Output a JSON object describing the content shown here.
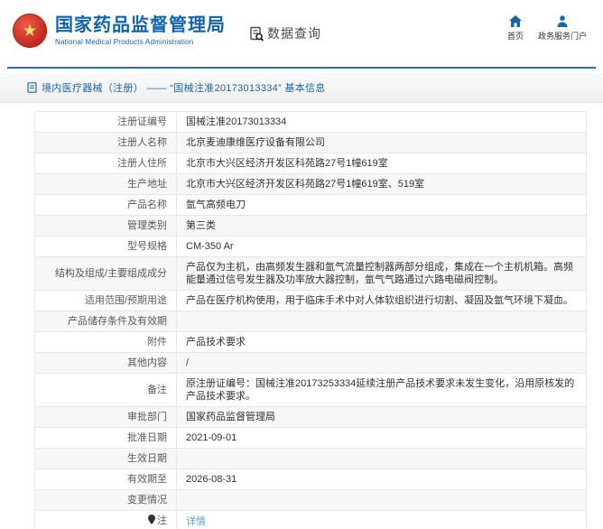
{
  "header": {
    "title_cn": "国家药品监督管理局",
    "title_en": "National Medical Products Administration",
    "section_label": "数据查询",
    "nav": [
      {
        "label": "首页",
        "icon": "home-icon"
      },
      {
        "label": "政务服务门户",
        "icon": "user-icon"
      }
    ]
  },
  "breadcrumb": {
    "icon": "document-icon",
    "text": "境内医疗器械（注册） —— “国械注准20173013334” 基本信息"
  },
  "colors": {
    "brand_blue": "#1064ad",
    "rule_blue": "#2f6ea8",
    "breadcrumb_text": "#1b66a8",
    "link_blue": "#55a1d8",
    "emblem_red": "#c0271a",
    "emblem_gold": "#ffd874"
  },
  "table": {
    "rows": [
      {
        "label": "注册证编号",
        "value": "国械注准20173013334"
      },
      {
        "label": "注册人名称",
        "value": "北京麦迪康维医疗设备有限公司"
      },
      {
        "label": "注册人住所",
        "value": "北京市大兴区经济开发区科苑路27号1幢619室"
      },
      {
        "label": "生产地址",
        "value": "北京市大兴区经济开发区科苑路27号1幢619室、519室"
      },
      {
        "label": "产品名称",
        "value": "氩气高频电刀"
      },
      {
        "label": "管理类别",
        "value": "第三类"
      },
      {
        "label": "型号规格",
        "value": "CM-350 Ar"
      },
      {
        "label": "结构及组成/主要组成成分",
        "value": "产品仅为主机，由高频发生器和氩气流量控制器两部分组成，集成在一个主机机箱。高频能量通过信号发生器及功率放大器控制，氩气气路通过六路电磁阀控制。"
      },
      {
        "label": "适用范围/预期用途",
        "value": "产品在医疗机构使用，用于临床手术中对人体软组织进行切割、凝固及氩气环境下凝血。"
      },
      {
        "label": "产品储存条件及有效期",
        "value": ""
      },
      {
        "label": "附件",
        "value": "产品技术要求"
      },
      {
        "label": "其他内容",
        "value": "/"
      },
      {
        "label": "备注",
        "value": "原注册证编号：国械注准20173253334延续注册产品技术要求未发生变化，沿用原核发的产品技术要求。"
      },
      {
        "label": "审批部门",
        "value": "国家药品监督管理局"
      },
      {
        "label": "批准日期",
        "value": "2021-09-01"
      },
      {
        "label": "生效日期",
        "value": ""
      },
      {
        "label": "有效期至",
        "value": "2026-08-31"
      },
      {
        "label": "变更情况",
        "value": ""
      },
      {
        "label": "注",
        "label_icon": "pin-icon",
        "value": "详情",
        "value_is_link": true
      }
    ]
  }
}
